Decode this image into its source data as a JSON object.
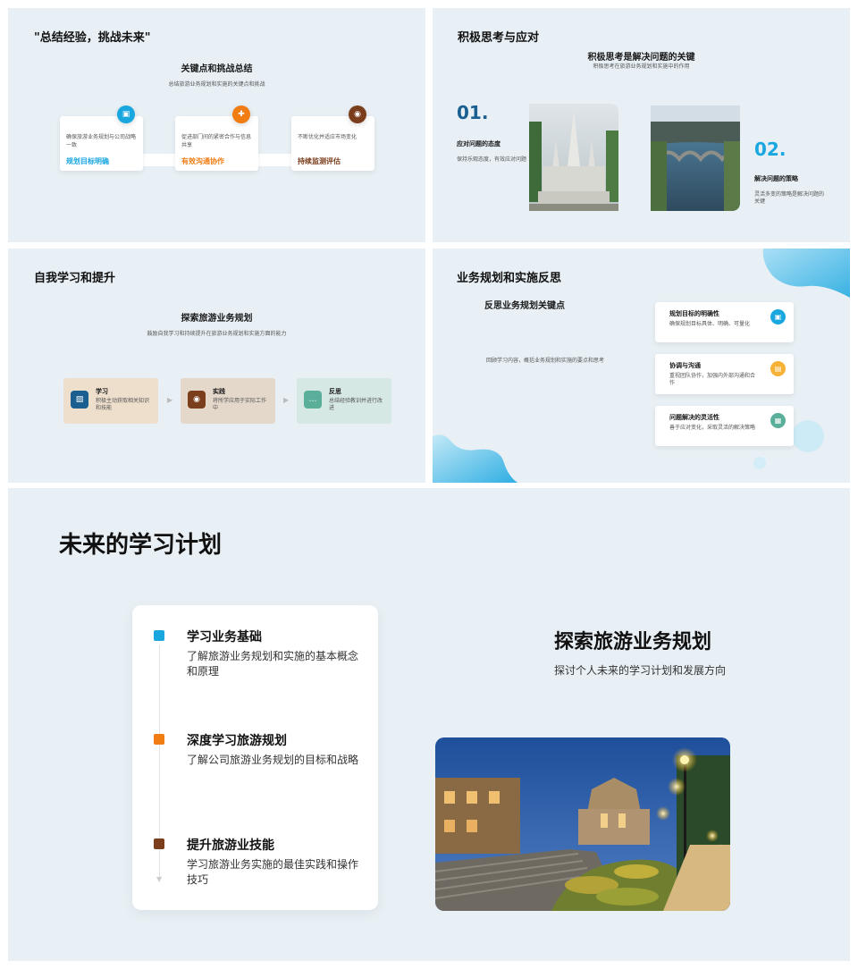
{
  "slide1": {
    "title": "\"总结经验，挑战未来\"",
    "heading": "关键点和挑战总结",
    "subheading": "总结旅游业务规划和实施的关键点和挑战",
    "cards": [
      {
        "desc": "确保旅游业务规划与公司战略一致",
        "label": "规划目标明确",
        "color": "#1aa7e0",
        "icon": "briefcase-icon"
      },
      {
        "desc": "促进部门间的紧密合作与信息共享",
        "label": "有效沟通协作",
        "color": "#f07c12",
        "icon": "puzzle-icon"
      },
      {
        "desc": "不断优化并适应市场变化",
        "label": "持续监测评估",
        "color": "#7a3e1d",
        "icon": "target-icon"
      }
    ]
  },
  "slide2": {
    "title": "积极思考与应对",
    "heading": "积极思考是解决问题的关键",
    "subheading": "积极思考在旅游业务规划和实施中的作用",
    "item1": {
      "num": "01.",
      "title": "应对问题的态度",
      "desc": "保持乐观态度，有效应对问题"
    },
    "item2": {
      "num": "02.",
      "title": "解决问题的策略",
      "desc": "灵活多变的策略是解决问题的关键"
    }
  },
  "slide3": {
    "title": "自我学习和提升",
    "heading": "探索旅游业务规划",
    "subheading": "鼓励自我学习和持续提升在旅游业务规划和实施方面的能力",
    "steps": [
      {
        "title": "学习",
        "desc": "积极主动获取相关知识和技能",
        "icon": "image-icon"
      },
      {
        "title": "实践",
        "desc": "将所学应用于实际工作中",
        "icon": "location-pin-icon"
      },
      {
        "title": "反思",
        "desc": "总结经验教训并进行改进",
        "icon": "chat-bubble-icon"
      }
    ]
  },
  "slide4": {
    "title": "业务规划和实施反思",
    "heading": "反思业务规划关键点",
    "desc": "回顾学习内容，概括业务规划和实施的要点和思考",
    "cards": [
      {
        "title": "规划目标的明确性",
        "desc": "确保规划目标具体、明确、可量化",
        "color": "#1aa7e0",
        "icon": "briefcase-icon"
      },
      {
        "title": "协调与沟通",
        "desc": "重视团队协作，加强内外部沟通和合作",
        "color": "#f5b236",
        "icon": "document-icon"
      },
      {
        "title": "问题解决的灵活性",
        "desc": "善于应对变化，采取灵活的解决策略",
        "color": "#5aaf9a",
        "icon": "grid-icon"
      }
    ]
  },
  "slide5": {
    "title": "未来的学习计划",
    "heading": "探索旅游业务规划",
    "subheading": "探讨个人未来的学习计划和发展方向",
    "items": [
      {
        "title": "学习业务基础",
        "desc": "了解旅游业务规划和实施的基本概念和原理",
        "color": "#1aa7e0"
      },
      {
        "title": "深度学习旅游规划",
        "desc": "了解公司旅游业务规划的目标和战略",
        "color": "#f07c12"
      },
      {
        "title": "提升旅游业技能",
        "desc": "学习旅游业务实施的最佳实践和操作技巧",
        "color": "#7a3e1d"
      }
    ]
  }
}
